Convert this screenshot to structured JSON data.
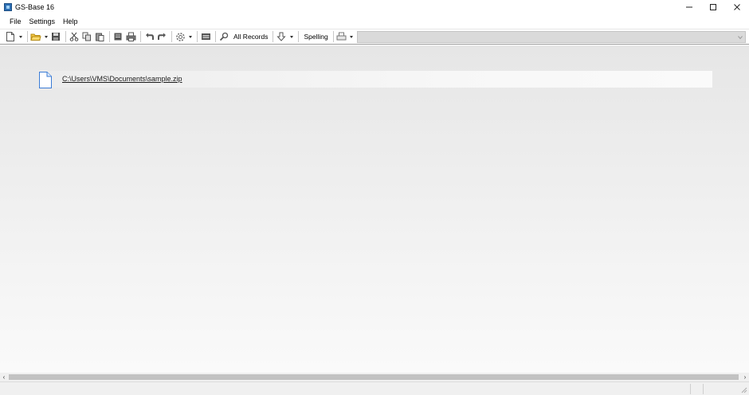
{
  "window": {
    "title": "GS-Base 16"
  },
  "window_controls": {
    "minimize": "—",
    "maximize": "☐",
    "close": "✕"
  },
  "menu": {
    "items": [
      "File",
      "Settings",
      "Help"
    ]
  },
  "toolbar": {
    "all_records_label": "All Records",
    "spelling_label": "Spelling"
  },
  "recent_files": [
    {
      "path": "C:\\Users\\VMS\\Documents\\sample.zip"
    }
  ],
  "scrollbar": {
    "left_arrow": "‹",
    "right_arrow": "›"
  },
  "colors": {
    "accent": "#2d6fb4",
    "toolbar_combo": "#dadada",
    "background_top": "#e6e6e6",
    "background_bottom": "#fafafa"
  }
}
